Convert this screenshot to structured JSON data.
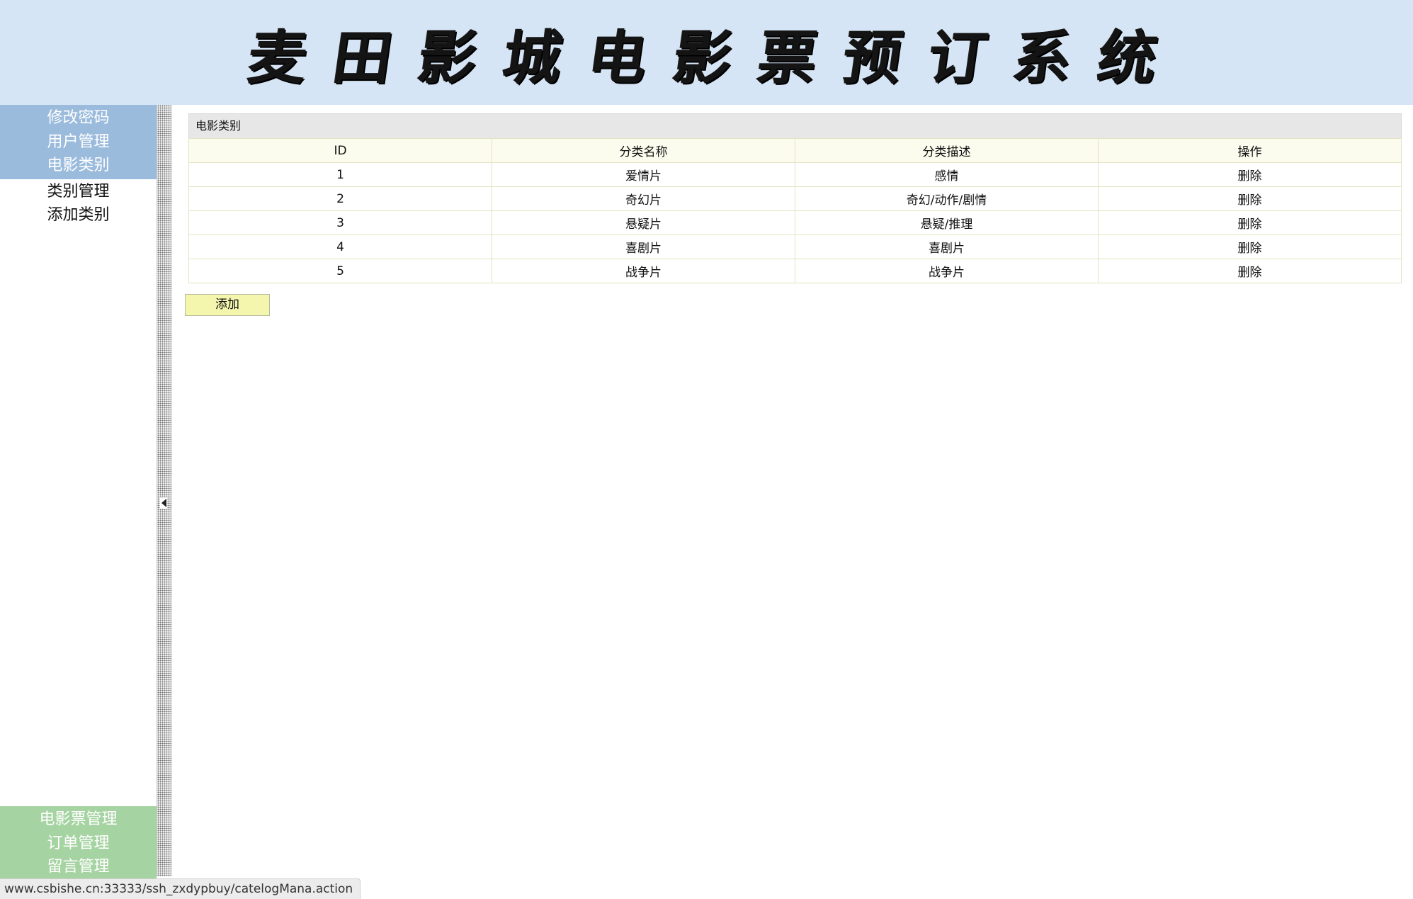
{
  "header": {
    "title": "麦田影城电影票预订系统"
  },
  "sidebar": {
    "top_items": [
      {
        "label": "修改密码"
      },
      {
        "label": "用户管理"
      },
      {
        "label": "电影类别"
      }
    ],
    "sub_items": [
      {
        "label": "类别管理"
      },
      {
        "label": "添加类别"
      }
    ],
    "bottom_items": [
      {
        "label": "电影票管理"
      },
      {
        "label": "订单管理"
      },
      {
        "label": "留言管理"
      }
    ]
  },
  "main": {
    "caption": "电影类别",
    "columns": [
      "ID",
      "分类名称",
      "分类描述",
      "操作"
    ],
    "rows": [
      {
        "id": "1",
        "name": "爱情片",
        "desc": "感情",
        "action": "删除"
      },
      {
        "id": "2",
        "name": "奇幻片",
        "desc": "奇幻/动作/剧情",
        "action": "删除"
      },
      {
        "id": "3",
        "name": "悬疑片",
        "desc": "悬疑/推理",
        "action": "删除"
      },
      {
        "id": "4",
        "name": "喜剧片",
        "desc": "喜剧片",
        "action": "删除"
      },
      {
        "id": "5",
        "name": "战争片",
        "desc": "战争片",
        "action": "删除"
      }
    ],
    "add_label": "添加"
  },
  "status": {
    "url": "www.csbishe.cn:33333/ssh_zxdypbuy/catelogMana.action"
  },
  "colors": {
    "header_bg": "#d6e5f5",
    "nav_blue": "#9bbbdc",
    "nav_green": "#a5d3a1",
    "table_header_bg": "#fbfbee",
    "add_button_bg": "#f5f6ad"
  },
  "icons": {
    "collapse": "triangle-left-icon"
  }
}
